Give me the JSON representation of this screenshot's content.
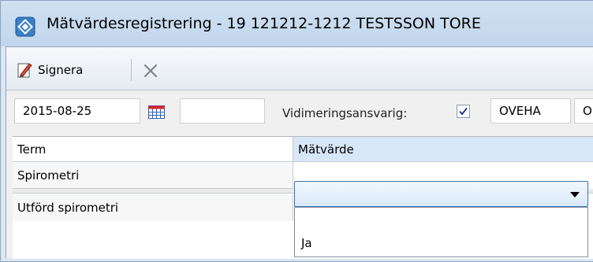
{
  "window": {
    "title": "Mätvärdesregistrering -  19 121212-1212 TESTSSON TORE",
    "icon": "diamond-app-icon"
  },
  "toolbar": {
    "sign_label": "Signera",
    "sign_icon": "pen-sign-icon",
    "close_icon": "x-icon"
  },
  "form": {
    "date_value": "2015-08-25",
    "time_value": "",
    "vidimering_label": "Vidimeringsansvarig:",
    "vidimering_checked": true,
    "responsible_code": "OVEHA",
    "responsible_name_partial": "O"
  },
  "grid": {
    "columns": [
      "Term",
      "Mätvärde"
    ],
    "rows": [
      {
        "term": "Spirometri",
        "value": ""
      },
      {
        "term": "Utförd spirometri",
        "value": ""
      }
    ],
    "dropdown_options": [
      "",
      "Ja"
    ]
  },
  "colors": {
    "titlebar": "#c8dbef",
    "window_frame": "#dce7f3",
    "combo_border": "#3b73b9",
    "grid_header_value": "#d7e7f7"
  }
}
